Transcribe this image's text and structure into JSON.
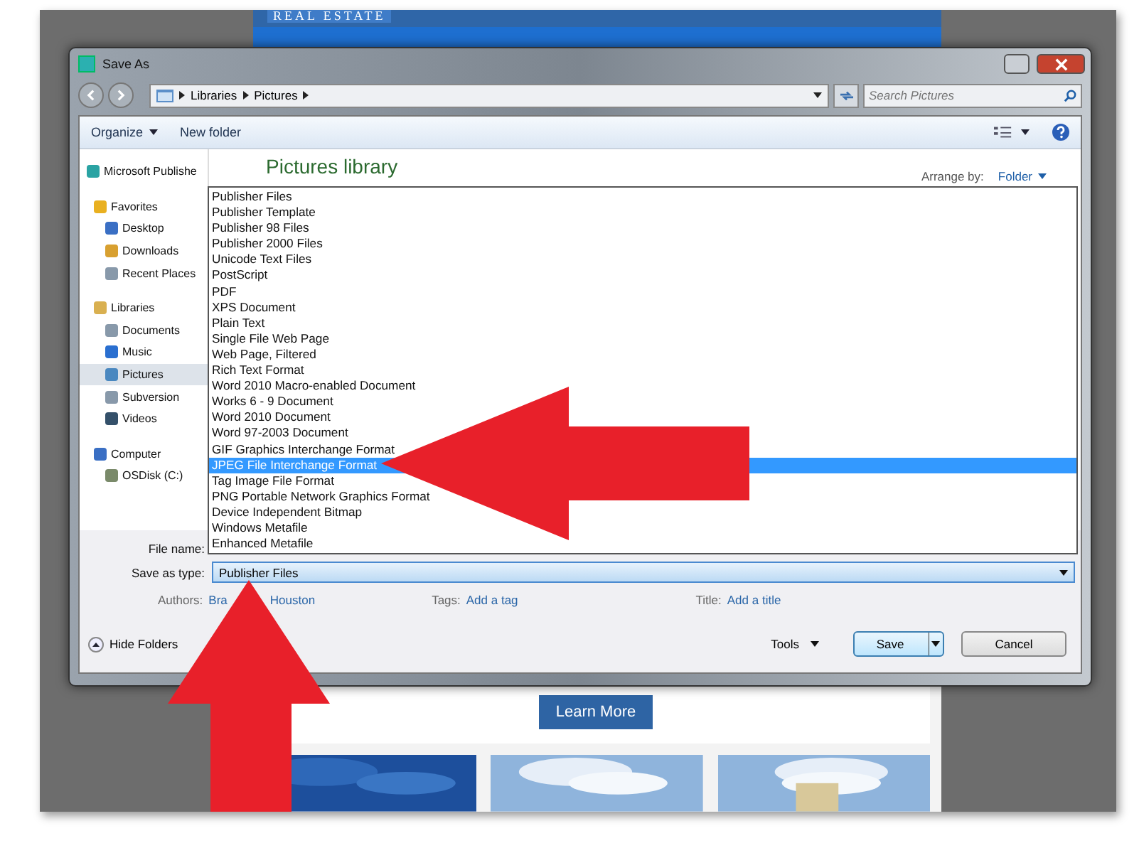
{
  "background_page": {
    "brand": "REAL ESTATE",
    "button": "Learn More"
  },
  "window": {
    "title": "Save As"
  },
  "address_bar": {
    "crumbs": [
      "Libraries",
      "Pictures"
    ]
  },
  "search": {
    "placeholder": "Search Pictures"
  },
  "toolbar": {
    "organize": "Organize",
    "new_folder": "New folder"
  },
  "nav": [
    {
      "label": "Microsoft Publishe",
      "kind": "item",
      "selected": false
    },
    {
      "label": "Favorites",
      "kind": "group",
      "selected": false
    },
    {
      "label": "Desktop",
      "kind": "item",
      "selected": false
    },
    {
      "label": "Downloads",
      "kind": "item",
      "selected": false
    },
    {
      "label": "Recent Places",
      "kind": "item",
      "selected": false
    },
    {
      "label": "Libraries",
      "kind": "group",
      "selected": false
    },
    {
      "label": "Documents",
      "kind": "item",
      "selected": false
    },
    {
      "label": "Music",
      "kind": "item",
      "selected": false
    },
    {
      "label": "Pictures",
      "kind": "item",
      "selected": true
    },
    {
      "label": "Subversion",
      "kind": "item",
      "selected": false
    },
    {
      "label": "Videos",
      "kind": "item",
      "selected": false
    },
    {
      "label": "Computer",
      "kind": "group",
      "selected": false
    },
    {
      "label": "OSDisk (C:)",
      "kind": "item",
      "selected": false
    }
  ],
  "library": {
    "title": "Pictures library",
    "arrange_label": "Arrange by:",
    "arrange_value": "Folder"
  },
  "type_list": [
    {
      "label": "Publisher Files",
      "selected": false
    },
    {
      "label": "Publisher Template",
      "selected": false
    },
    {
      "label": "Publisher 98 Files",
      "selected": false
    },
    {
      "label": "Publisher 2000 Files",
      "selected": false
    },
    {
      "label": "Unicode Text Files",
      "selected": false
    },
    {
      "label": "PostScript",
      "selected": false
    },
    {
      "label": "PDF",
      "selected": false
    },
    {
      "label": "XPS Document",
      "selected": false
    },
    {
      "label": "Plain Text",
      "selected": false
    },
    {
      "label": "Single File Web Page",
      "selected": false
    },
    {
      "label": "Web Page, Filtered",
      "selected": false
    },
    {
      "label": "Rich Text Format",
      "selected": false
    },
    {
      "label": "Word 2010 Macro-enabled Document",
      "selected": false
    },
    {
      "label": "Works 6 - 9 Document",
      "selected": false
    },
    {
      "label": "Word 2010 Document",
      "selected": false
    },
    {
      "label": "Word 97-2003 Document",
      "selected": false
    },
    {
      "label": "GIF Graphics Interchange Format",
      "selected": false
    },
    {
      "label": "JPEG File Interchange Format",
      "selected": true
    },
    {
      "label": "Tag Image File Format",
      "selected": false
    },
    {
      "label": "PNG Portable Network Graphics Format",
      "selected": false
    },
    {
      "label": "Device Independent Bitmap",
      "selected": false
    },
    {
      "label": "Windows Metafile",
      "selected": false
    },
    {
      "label": "Enhanced Metafile",
      "selected": false
    }
  ],
  "file_name": {
    "label": "File name:"
  },
  "save_as_type": {
    "label": "Save as type:",
    "value": "Publisher Files"
  },
  "metadata": {
    "authors_label": "Authors:",
    "authors_visible_start": "Bra",
    "authors_visible_end": "Houston",
    "tags_label": "Tags:",
    "tags_value": "Add a tag",
    "title_label": "Title:",
    "title_value": "Add a title"
  },
  "footer": {
    "hide_folders": "Hide Folders",
    "tools": "Tools",
    "save": "Save",
    "cancel": "Cancel"
  }
}
